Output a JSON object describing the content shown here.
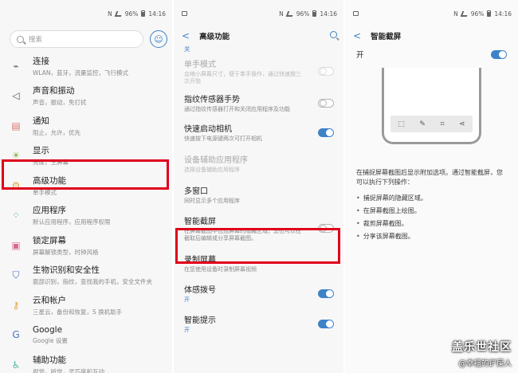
{
  "status": {
    "battery": "96%",
    "time": "14:16"
  },
  "settings": {
    "search_placeholder": "搜索",
    "items": [
      {
        "title": "连接",
        "sub": "WLAN，蓝牙，流量监控，飞行模式",
        "icon": "link-icon",
        "color": "#555555"
      },
      {
        "title": "声音和振动",
        "sub": "声音，振动，免打扰",
        "icon": "speaker-icon",
        "color": "#555555"
      },
      {
        "title": "通知",
        "sub": "阻止，允许，优先",
        "icon": "notification-icon",
        "color": "#e07373"
      },
      {
        "title": "显示",
        "sub": "亮度，主屏幕",
        "icon": "brightness-icon",
        "color": "#8ab34a"
      },
      {
        "title": "高级功能",
        "sub": "单手模式",
        "icon": "gear-icon",
        "color": "#e2a33a"
      },
      {
        "title": "应用程序",
        "sub": "默认应用程序，应用程序权限",
        "icon": "apps-grid-icon",
        "color": "#4fb6a3"
      },
      {
        "title": "锁定屏幕",
        "sub": "屏幕解锁类型，时钟风格",
        "icon": "lock-icon",
        "color": "#d96a8c"
      },
      {
        "title": "生物识别和安全性",
        "sub": "面部识别，指纹，查找我的手机，安全文件夹",
        "icon": "shield-icon",
        "color": "#4a74c0"
      },
      {
        "title": "云和帐户",
        "sub": "三星云，备份和恢复，S 换机助手",
        "icon": "key-icon",
        "color": "#e2a33a"
      },
      {
        "title": "Google",
        "sub": "Google 设置",
        "icon": "google-icon",
        "color": "#4a74c0"
      },
      {
        "title": "辅助功能",
        "sub": "视觉，听觉，灵巧度和互动",
        "icon": "accessibility-icon",
        "color": "#4fb6a3"
      }
    ]
  },
  "advanced": {
    "title": "高级功能",
    "cut_sub": "关",
    "items": [
      {
        "title": "单手模式",
        "sub": "会缩小屏幕尺寸，便于单手操作，通过快速按三次开始",
        "toggle": "disabled",
        "dim": true
      },
      {
        "title": "指纹传感器手势",
        "sub": "通过指纹传感器打开和关闭应用程序及功能",
        "toggle": "off",
        "dim": false
      },
      {
        "title": "快速启动相机",
        "sub": "快速按下电源键两次可打开相机",
        "toggle": "on",
        "dim": false
      },
      {
        "title": "设备辅助应用程序",
        "sub": "选择设备辅助应用程序",
        "toggle": "none",
        "dim": true
      },
      {
        "title": "多窗口",
        "sub": "同时显示多个应用程序",
        "toggle": "none",
        "dim": false
      },
      {
        "title": "智能截屏",
        "sub": "在屏幕截图中包括屏幕的隐藏区域，您也可以在截取后编辑或分享屏幕截图。",
        "toggle": "off",
        "dim": false
      },
      {
        "title": "录制屏幕",
        "sub": "在您使用设备时录制屏幕视频",
        "toggle": "none",
        "dim": false
      },
      {
        "title": "体感拨号",
        "sub": "开",
        "toggle": "on",
        "dim": false,
        "blue": true
      },
      {
        "title": "智能提示",
        "sub": "开",
        "toggle": "on",
        "dim": false,
        "blue": true
      }
    ]
  },
  "smart_capture": {
    "title": "智能截屏",
    "switch_label": "开",
    "description": "在捕捉屏幕截图后显示附加选项。通过智能截屏，您可以执行下列操作：",
    "bullets": [
      "捕捉屏幕的隐藏区域。",
      "在屏幕截图上绘图。",
      "裁剪屏幕截图。",
      "分享该屏幕截图。"
    ]
  },
  "watermark": {
    "line1": "盖乐世社区",
    "line2": "@幸福的铲屎人"
  },
  "colors": {
    "accent": "#3e82c8",
    "highlight": "#e0001b"
  }
}
